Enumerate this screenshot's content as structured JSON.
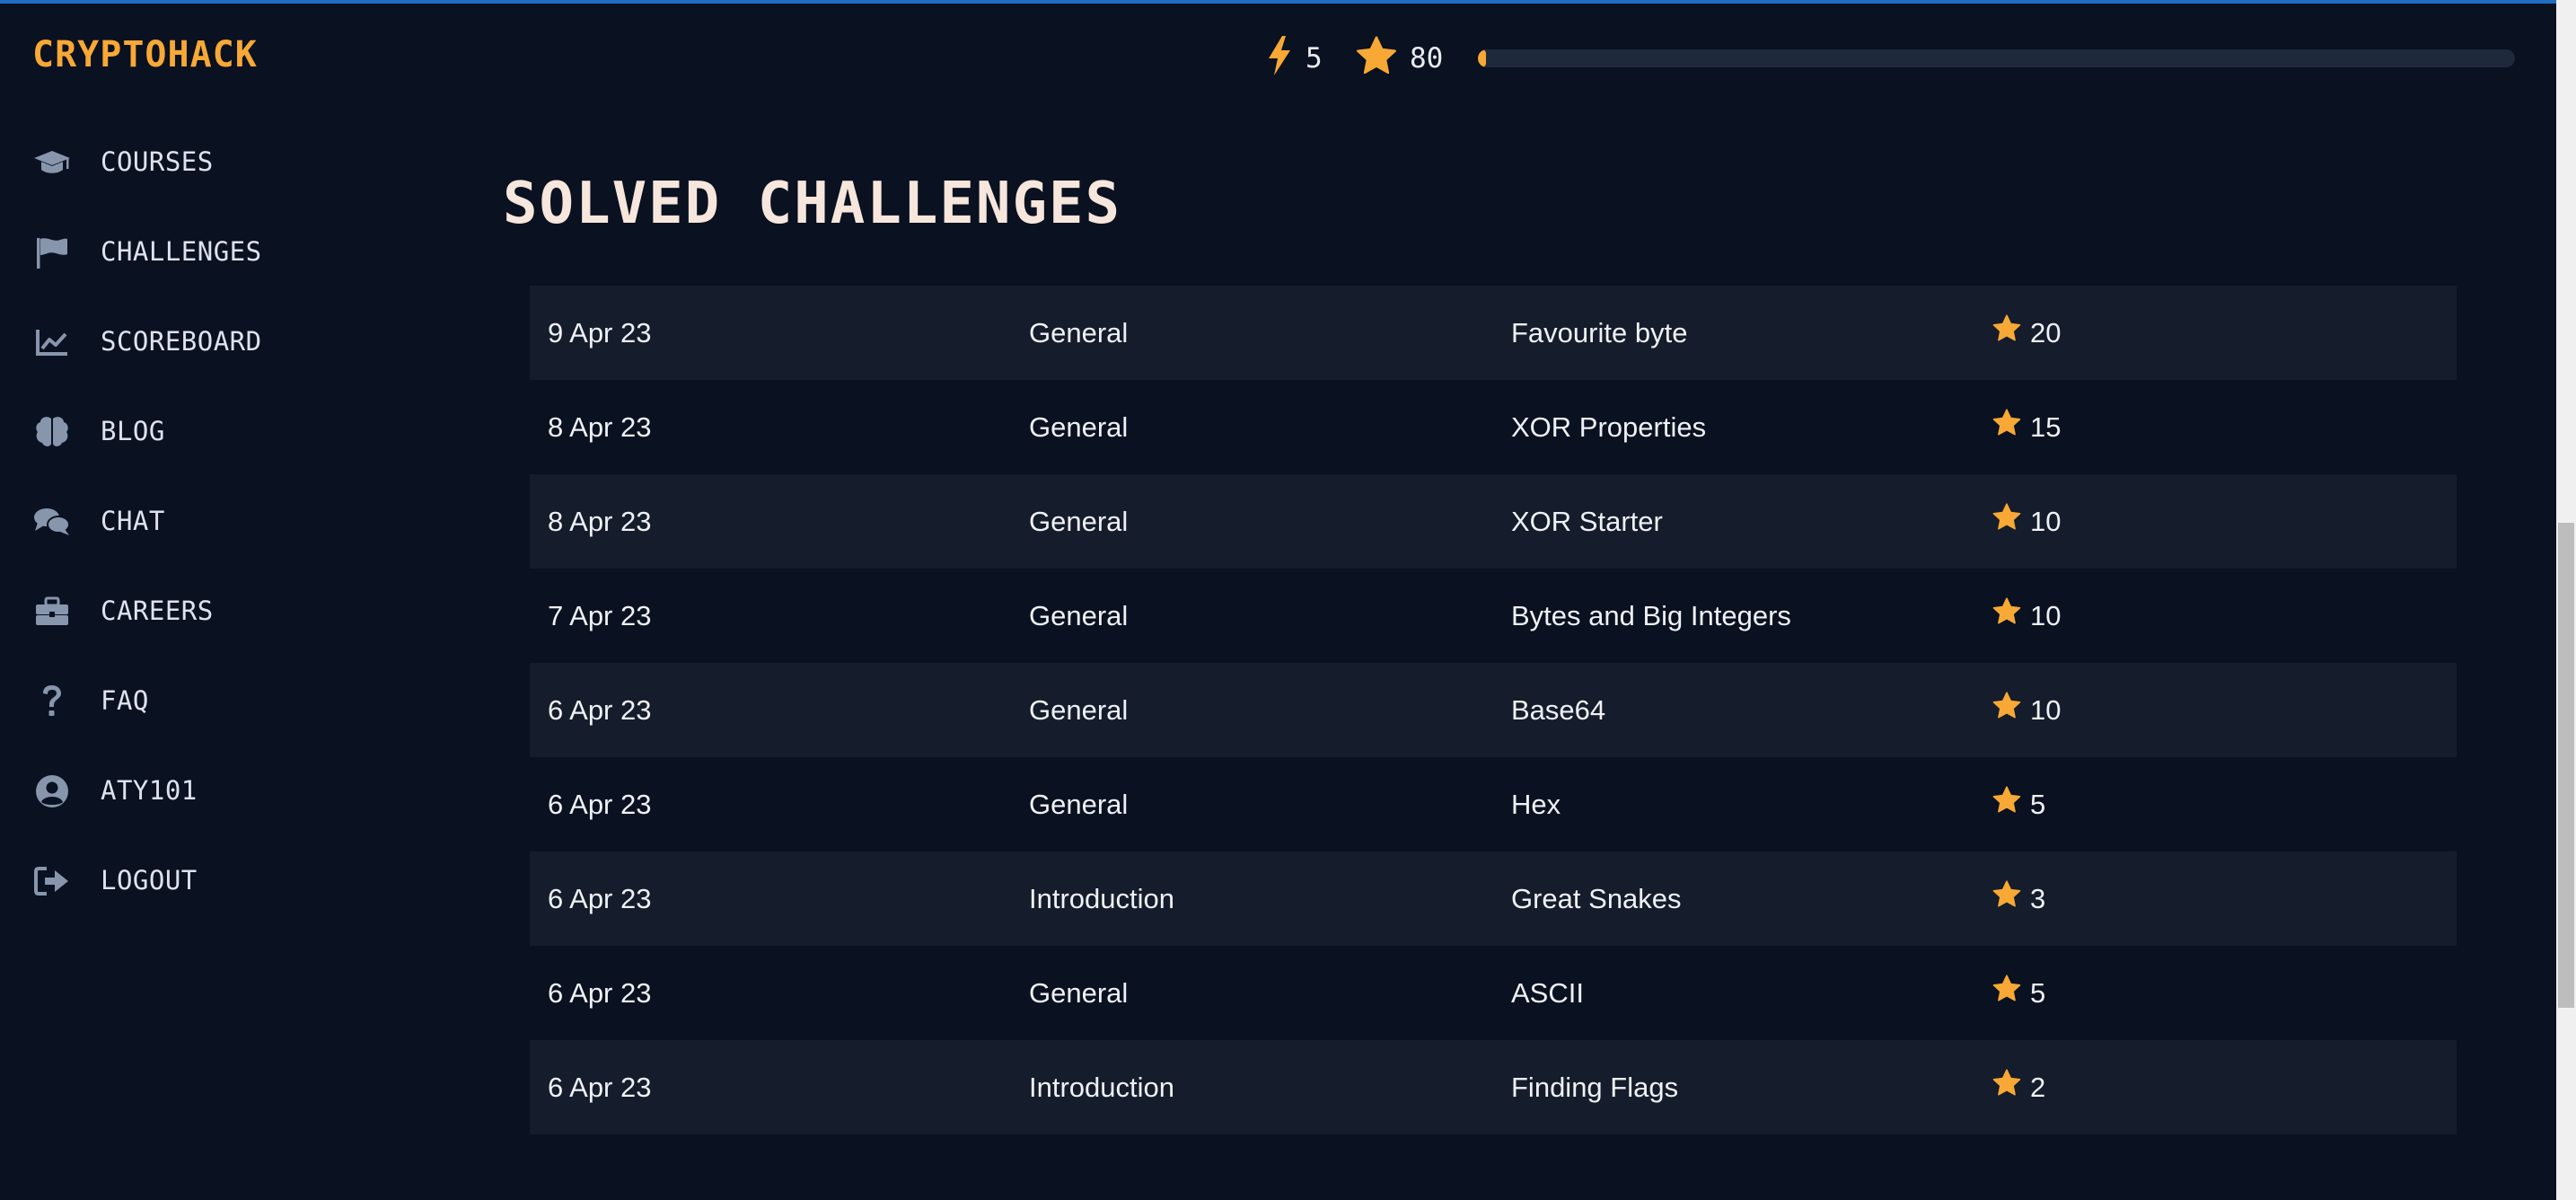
{
  "brand": "CRYPTOHACK",
  "header": {
    "streak": "5",
    "score": "80",
    "progress_fraction": 0.008,
    "accent_color": "#f7a835"
  },
  "sidebar": {
    "items": [
      {
        "label": "COURSES",
        "icon": "graduation-cap-icon"
      },
      {
        "label": "CHALLENGES",
        "icon": "flag-icon"
      },
      {
        "label": "SCOREBOARD",
        "icon": "chart-line-icon"
      },
      {
        "label": "BLOG",
        "icon": "brain-icon"
      },
      {
        "label": "CHAT",
        "icon": "comments-icon"
      },
      {
        "label": "CAREERS",
        "icon": "briefcase-icon"
      },
      {
        "label": "FAQ",
        "icon": "question-icon"
      },
      {
        "label": "ATY101",
        "icon": "user-circle-icon"
      },
      {
        "label": "LOGOUT",
        "icon": "sign-out-icon"
      }
    ]
  },
  "main": {
    "title": "SOLVED CHALLENGES",
    "rows": [
      {
        "date": "9 Apr 23",
        "category": "General",
        "name": "Favourite byte",
        "points": "20"
      },
      {
        "date": "8 Apr 23",
        "category": "General",
        "name": "XOR Properties",
        "points": "15"
      },
      {
        "date": "8 Apr 23",
        "category": "General",
        "name": "XOR Starter",
        "points": "10"
      },
      {
        "date": "7 Apr 23",
        "category": "General",
        "name": "Bytes and Big Integers",
        "points": "10"
      },
      {
        "date": "6 Apr 23",
        "category": "General",
        "name": "Base64",
        "points": "10"
      },
      {
        "date": "6 Apr 23",
        "category": "General",
        "name": "Hex",
        "points": "5"
      },
      {
        "date": "6 Apr 23",
        "category": "Introduction",
        "name": "Great Snakes",
        "points": "3"
      },
      {
        "date": "6 Apr 23",
        "category": "General",
        "name": "ASCII",
        "points": "5"
      },
      {
        "date": "6 Apr 23",
        "category": "Introduction",
        "name": "Finding Flags",
        "points": "2"
      }
    ]
  }
}
